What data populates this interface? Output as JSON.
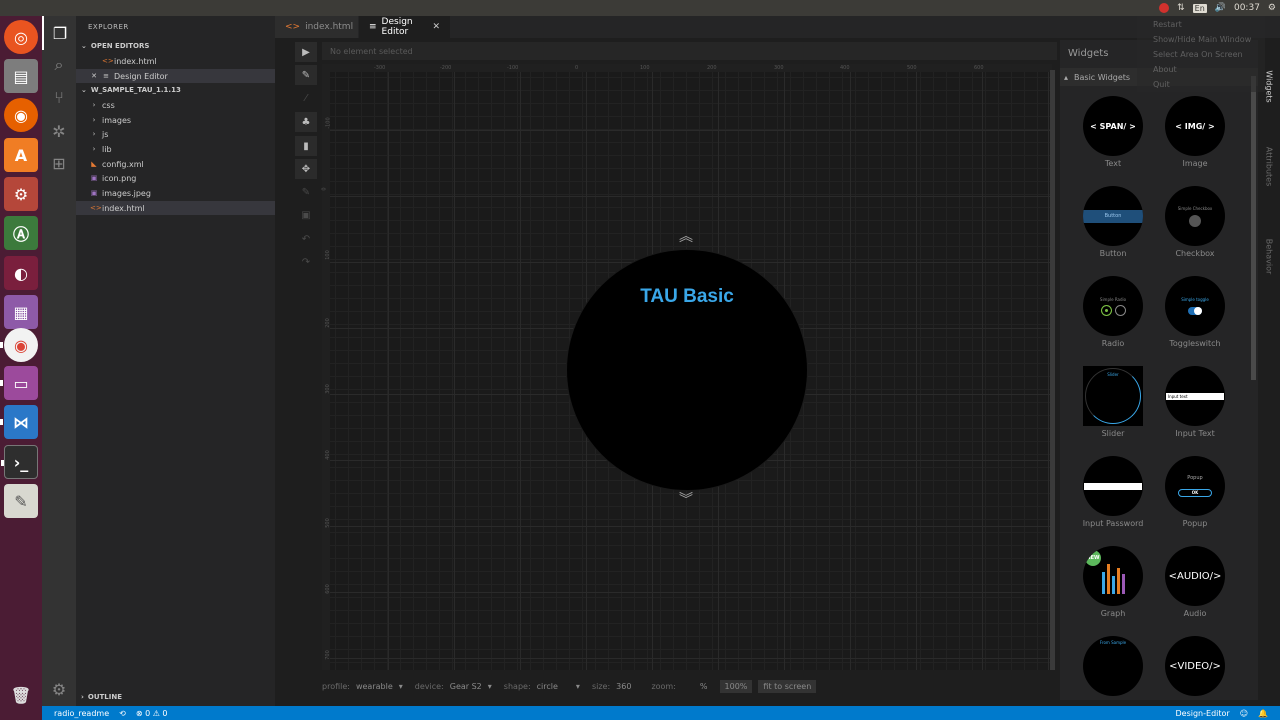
{
  "system": {
    "clock": "00:37",
    "keyboard": "En"
  },
  "sidebar": {
    "title": "EXPLORER",
    "open_editors_label": "OPEN EDITORS",
    "open_editors": [
      "index.html",
      "Design Editor"
    ],
    "project_label": "W_SAMPLE_TAU_1.1.13",
    "tree": [
      {
        "name": "css",
        "type": "folder"
      },
      {
        "name": "images",
        "type": "folder"
      },
      {
        "name": "js",
        "type": "folder"
      },
      {
        "name": "lib",
        "type": "folder"
      },
      {
        "name": "config.xml",
        "type": "xml"
      },
      {
        "name": "icon.png",
        "type": "image"
      },
      {
        "name": "images.jpeg",
        "type": "image"
      },
      {
        "name": "index.html",
        "type": "html"
      }
    ],
    "outline_label": "OUTLINE"
  },
  "tabs": [
    {
      "label": "index.html",
      "active": false
    },
    {
      "label": "Design Editor",
      "active": true
    }
  ],
  "design": {
    "selection_text": "No element selected",
    "watch_title": "TAU Basic",
    "hruler": [
      "-300",
      "-200",
      "-100",
      "0",
      "100",
      "200",
      "300",
      "400",
      "500",
      "600"
    ],
    "vruler": [
      "-100",
      "0",
      "100",
      "200",
      "300",
      "400",
      "500",
      "600",
      "700"
    ]
  },
  "props": {
    "profile_label": "profile:",
    "profile_value": "wearable",
    "device_label": "device:",
    "device_value": "Gear S2",
    "shape_label": "shape:",
    "shape_value": "circle",
    "size_label": "size:",
    "size_value": "360",
    "zoom_label": "zoom:",
    "zoom_unit": "%",
    "zoom_100": "100%",
    "fit_label": "fit to screen"
  },
  "widgets": {
    "title": "Widgets",
    "group": "Basic Widgets",
    "items": [
      {
        "label": "Text",
        "thumb": "< SPAN/ >"
      },
      {
        "label": "Image",
        "thumb": "< IMG/ >"
      },
      {
        "label": "Button",
        "thumb": "Button"
      },
      {
        "label": "Checkbox",
        "thumb": "Simple Checkbox"
      },
      {
        "label": "Radio",
        "thumb": "Simple Radio"
      },
      {
        "label": "Toggleswitch",
        "thumb": "Simple toggle"
      },
      {
        "label": "Slider",
        "thumb": "Slider"
      },
      {
        "label": "Input Text",
        "thumb": "Input text"
      },
      {
        "label": "Input Password",
        "thumb": ""
      },
      {
        "label": "Popup",
        "thumb": "Popup"
      },
      {
        "label": "Graph",
        "thumb": "NEW"
      },
      {
        "label": "Audio",
        "thumb": "<AUDIO/>"
      },
      {
        "label": "",
        "thumb": "From Sample"
      },
      {
        "label": "",
        "thumb": "<VIDEO/>"
      }
    ]
  },
  "vtabs": [
    "Widgets",
    "Attributes",
    "Behavior"
  ],
  "menu": [
    "Restart",
    "Show/Hide Main Window",
    "Select Area On Screen",
    "About",
    "Quit"
  ],
  "status": {
    "branch": "radio_readme",
    "problems": "⊗ 0 ⚠ 0",
    "right": "Design-Editor"
  }
}
